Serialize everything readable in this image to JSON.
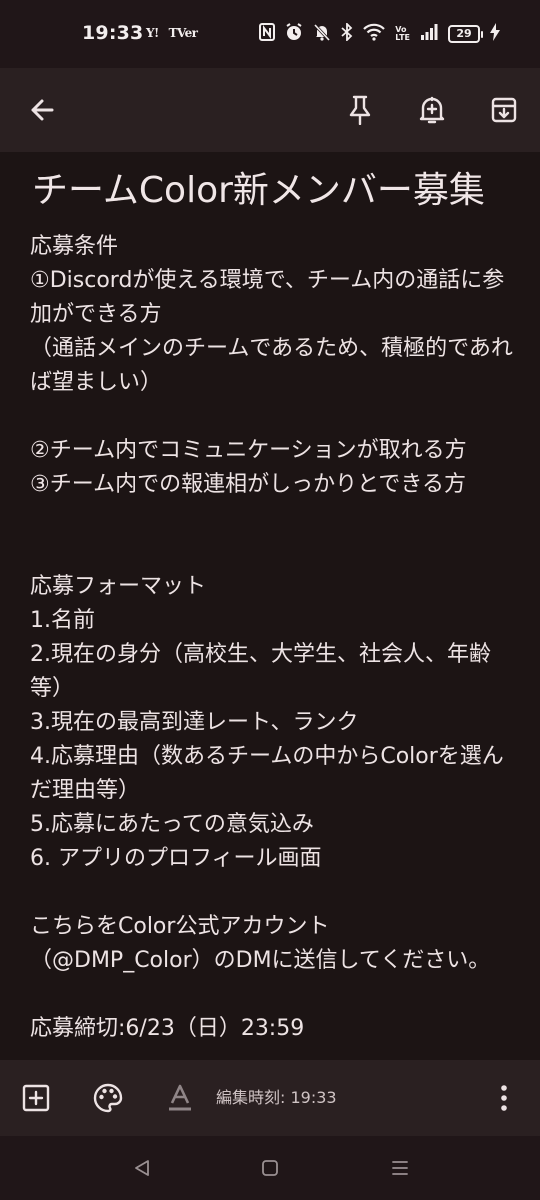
{
  "status_bar": {
    "time": "19:33",
    "app_icons": [
      "Y!",
      "TVer"
    ],
    "system_icons": [
      "nfc-icon",
      "alarm-icon",
      "mute-icon",
      "bluetooth-icon",
      "wifi-icon",
      "volte-icon",
      "signal-icon",
      "battery-icon",
      "charging-icon"
    ],
    "volte_text": [
      "Vo",
      "LTE"
    ],
    "battery_level": "29"
  },
  "toolbar": {
    "back_icon": "arrow-left-icon",
    "pin_icon": "pin-icon",
    "reminder_icon": "bell-plus-icon",
    "archive_icon": "archive-icon"
  },
  "note": {
    "title": "チームColor新メンバー募集",
    "body": "応募条件\n①Discordが使える環境で、チーム内の通話に参加ができる方\n（通話メインのチームであるため、積極的であれば望ましい）\n\n②チーム内でコミュニケーションが取れる方\n③チーム内での報連相がしっかりとできる方\n\n\n応募フォーマット\n1.名前\n2.現在の身分（高校生、大学生、社会人、年齢等）\n3.現在の最高到達レート、ランク\n4.応募理由（数あるチームの中からColorを選んだ理由等）\n5.応募にあたっての意気込み\n6. アプリのプロフィール画面\n\nこちらをColor公式アカウント\n（@DMP_Color）のDMに送信してください。\n\n応募締切:6/23（日）23:59"
  },
  "bottom_bar": {
    "edited_label": "編集時刻: 19:33",
    "icons": [
      "add-box-icon",
      "palette-icon",
      "text-format-icon",
      "more-vert-icon"
    ]
  },
  "nav_bar": {
    "icons": [
      "back-triangle-icon",
      "home-square-icon",
      "recents-menu-icon"
    ]
  }
}
